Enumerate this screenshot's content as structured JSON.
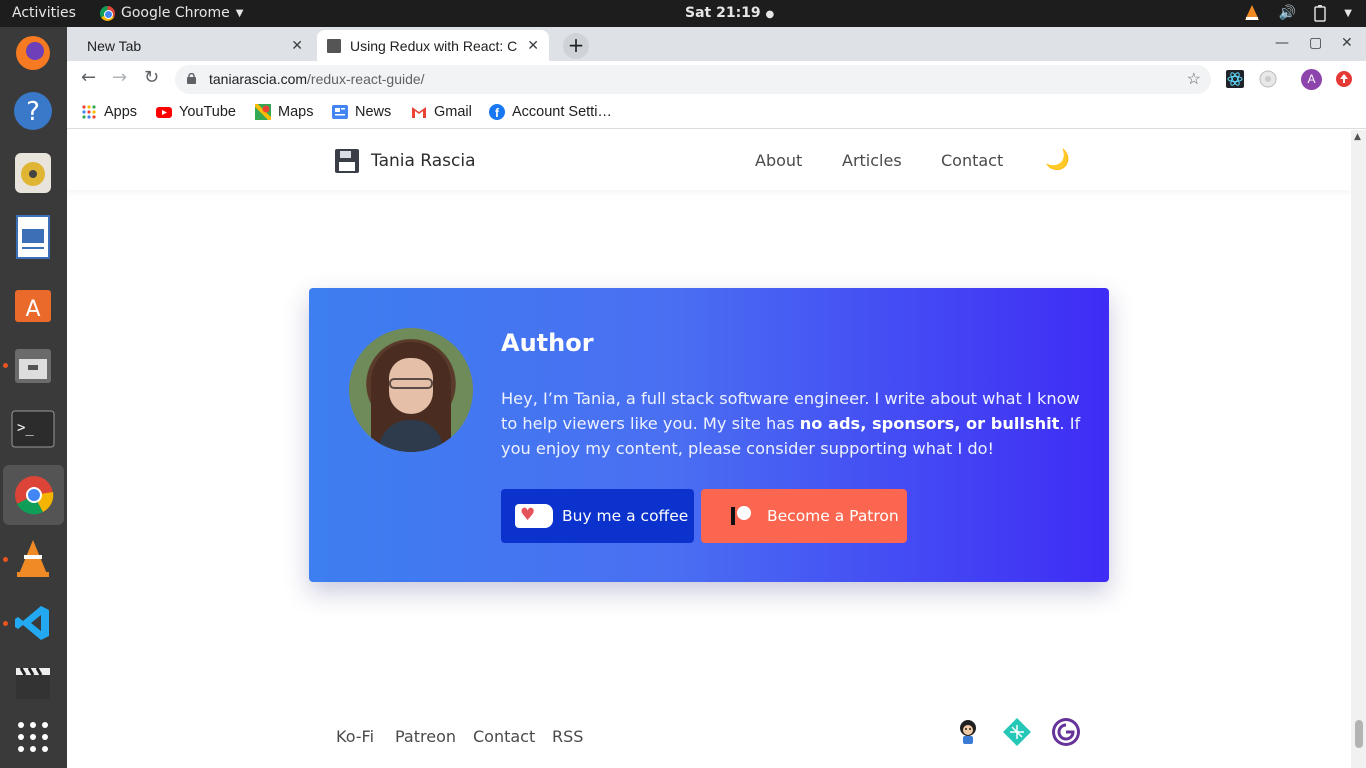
{
  "os": {
    "activities": "Activities",
    "app_name": "Google Chrome",
    "clock": "Sat 21:19"
  },
  "dock": [
    "firefox-icon",
    "help-icon",
    "rhythmbox-icon",
    "writer-icon",
    "software-center-icon",
    "files-icon",
    "terminal-icon",
    "chrome-icon",
    "vlc-icon",
    "vscode-icon",
    "clapper-icon",
    "show-apps-icon"
  ],
  "browser": {
    "tabs": [
      {
        "title": "New Tab"
      },
      {
        "title": "Using Redux with React: C"
      }
    ],
    "url_host": "taniarascia.com",
    "url_path": "/redux-react-guide/",
    "profile_initial": "A",
    "bookmarks": [
      "Apps",
      "YouTube",
      "Maps",
      "News",
      "Gmail",
      "Account Setti…"
    ]
  },
  "site": {
    "brand": "Tania Rascia",
    "nav": [
      "About",
      "Articles",
      "Contact"
    ],
    "author_card": {
      "heading": "Author",
      "bio_intro": "Hey, I’m Tania, a full stack software engineer. I write about what I know to help viewers like you. My site has ",
      "bio_bold": "no ads, sponsors, or bullshit",
      "bio_end": ". If you enjoy my content, please consider supporting what I do!",
      "coffee_button": "Buy me a coffee",
      "patron_button": "Become a Patron"
    },
    "footer_links": [
      "Ko-Fi",
      "Patreon",
      "Contact",
      "RSS"
    ]
  }
}
